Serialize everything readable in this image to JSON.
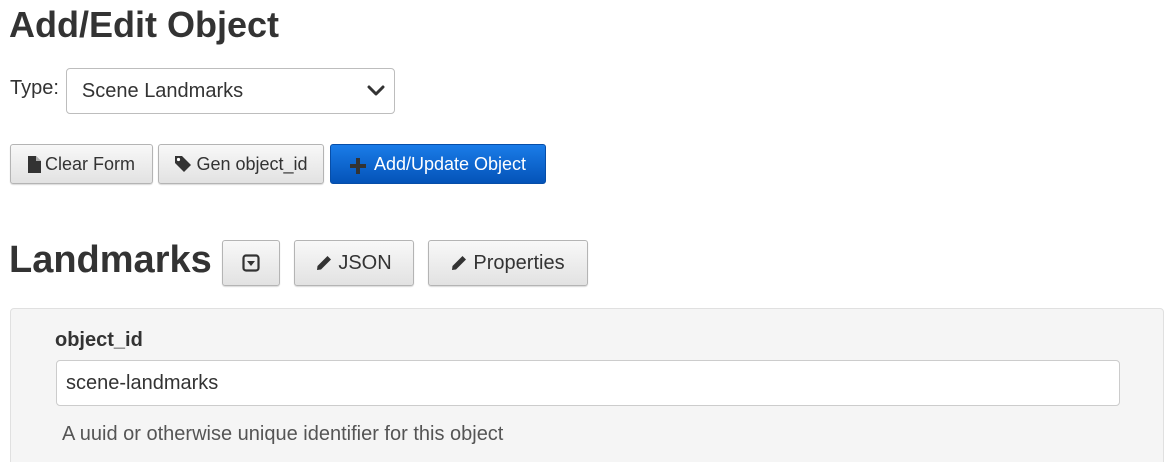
{
  "page_title": "Add/Edit Object",
  "type_selector": {
    "label": "Type:",
    "selected": "Scene Landmarks"
  },
  "toolbar": {
    "clear_form_label": "Clear Form",
    "gen_id_label": "Gen object_id",
    "add_update_label": "Add/Update Object"
  },
  "section": {
    "title": "Landmarks",
    "json_label": "JSON",
    "properties_label": "Properties"
  },
  "form": {
    "object_id_label": "object_id",
    "object_id_value": "scene-landmarks",
    "object_id_help": "A uuid or otherwise unique identifier for this object"
  },
  "colors": {
    "primary": "#0a62d0",
    "well_background": "#f5f5f5",
    "text": "#333333"
  }
}
